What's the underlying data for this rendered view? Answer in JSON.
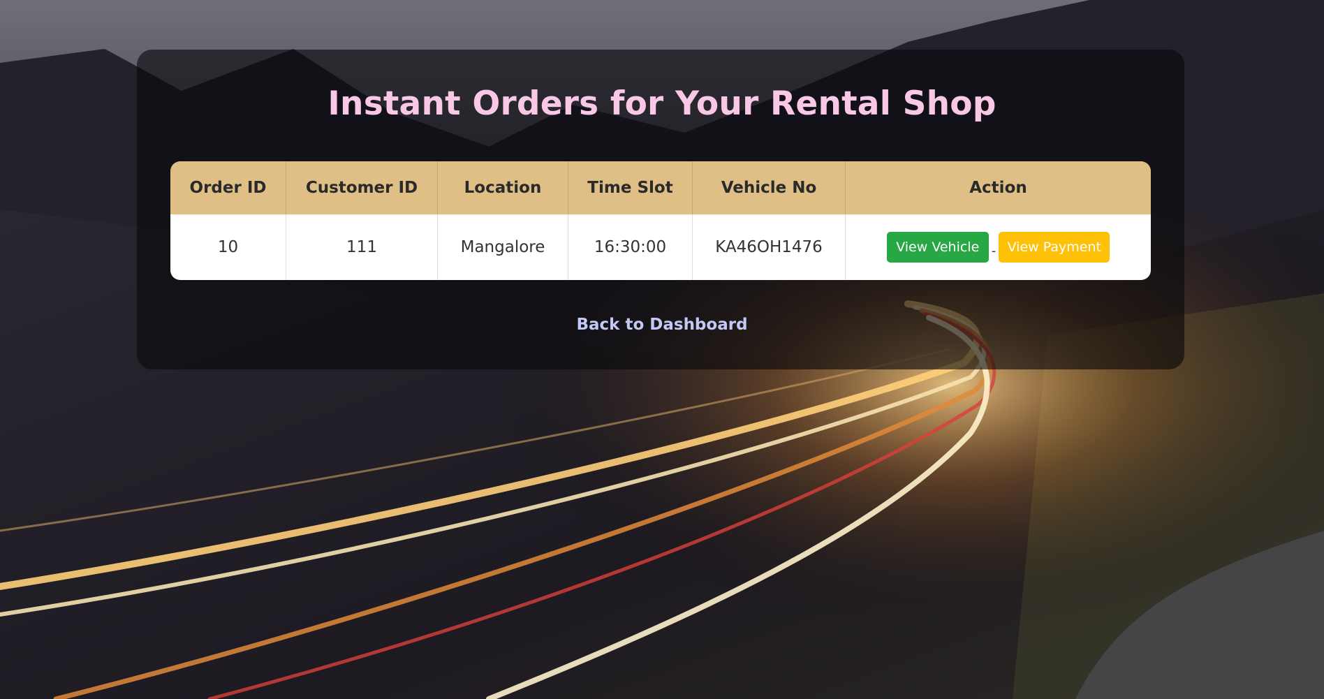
{
  "page": {
    "title": "Instant Orders for Your Rental Shop",
    "back_link": "Back to Dashboard"
  },
  "table": {
    "headers": [
      "Order ID",
      "Customer ID",
      "Location",
      "Time Slot",
      "Vehicle No",
      "Action"
    ],
    "rows": [
      {
        "order_id": "10",
        "customer_id": "111",
        "location": "Mangalore",
        "time_slot": "16:30:00",
        "vehicle_no": "KA46OH1476",
        "actions": {
          "view_vehicle": "View Vehicle",
          "separator": "-",
          "view_payment": "View Payment"
        }
      }
    ]
  },
  "colors": {
    "title": "#f8c8e6",
    "header_bg": "#dfbf85",
    "view_vehicle_bg": "#28a745",
    "view_payment_bg": "#ffc107",
    "link": "#c2c9f4"
  }
}
